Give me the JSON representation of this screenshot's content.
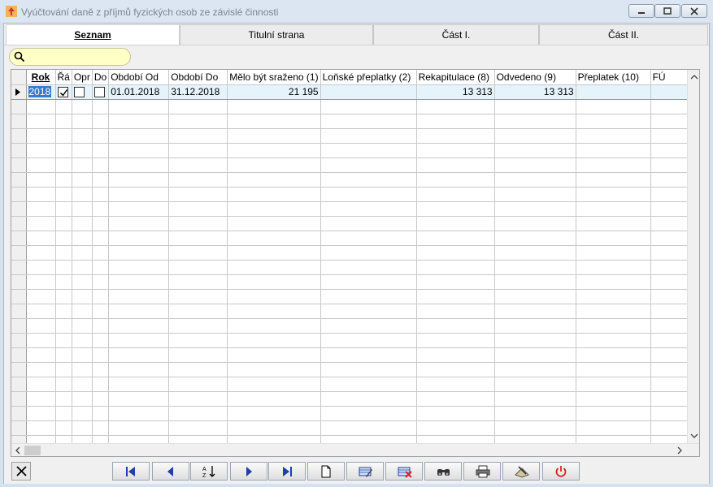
{
  "window": {
    "title": "Vyúčtování daně z příjmů fyzických osob ze závislé činnosti"
  },
  "tabs": [
    {
      "label": "Seznam",
      "active": true
    },
    {
      "label": "Titulní strana",
      "active": false
    },
    {
      "label": "Část I.",
      "active": false
    },
    {
      "label": "Část II.",
      "active": false
    }
  ],
  "search": {
    "value": "",
    "placeholder": ""
  },
  "grid": {
    "columns": [
      "Rok",
      "Řá",
      "Opr",
      "Do",
      "Období Od",
      "Období Do",
      "Mělo být sraženo (1)",
      "Loňské přeplatky (2)",
      "Rekapitulace (8)",
      "Odvedeno (9)",
      "Přeplatek (10)",
      "FÚ"
    ],
    "rows": [
      {
        "rok": "2018",
        "radny": true,
        "opravny": false,
        "dodatecny": false,
        "obdobi_od": "01.01.2018",
        "obdobi_do": "31.12.2018",
        "melo_byt_srazeno": "21 195",
        "lonske_preplatky": "",
        "rekapitulace": "13 313",
        "odvedeno": "13 313",
        "preplatek": "",
        "fu": ""
      }
    ]
  },
  "toolbar": {
    "buttons": [
      "first-icon",
      "prev-icon",
      "sort-az-icon",
      "next-icon",
      "last-icon",
      "new-document-icon",
      "edit-icon",
      "delete-icon",
      "find-icon",
      "print-icon",
      "export-icon",
      "power-icon"
    ]
  },
  "colors": {
    "accent": "#3a78c9",
    "power": "#e02020",
    "search_bg": "#ffffc6"
  }
}
